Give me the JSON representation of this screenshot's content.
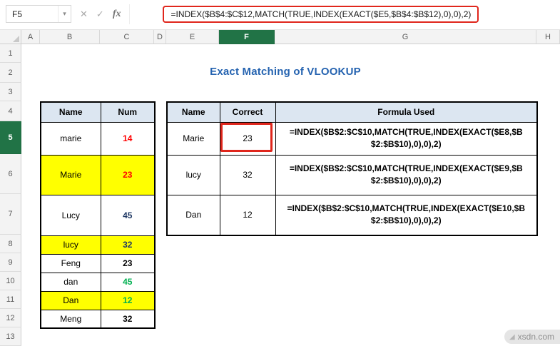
{
  "formula_bar": {
    "name_box": "F5",
    "cancel_icon": "✕",
    "enter_icon": "✓",
    "fx_label": "fx",
    "dropdown_icon": "▼",
    "formula": "=INDEX($B$4:$C$12,MATCH(TRUE,INDEX(EXACT($E5,$B$4:$B$12),0),0),2)"
  },
  "grid": {
    "column_headers": [
      "A",
      "B",
      "C",
      "D",
      "E",
      "F",
      "G",
      "H"
    ],
    "row_headers": [
      "1",
      "2",
      "3",
      "4",
      "5",
      "6",
      "7",
      "8",
      "9",
      "10",
      "11",
      "12",
      "13"
    ],
    "selected_column": "F",
    "selected_row": "5",
    "selected_cell": "F5"
  },
  "title": "Exact Matching of VLOOKUP",
  "left_table": {
    "headers": [
      "Name",
      "Num"
    ],
    "rows": [
      {
        "name": "marie",
        "num": "14",
        "num_color": "#FF0000",
        "bg": "#FFFFFF"
      },
      {
        "name": "Marie",
        "num": "23",
        "num_color": "#FF0000",
        "bg": "#FFFF00"
      },
      {
        "name": "Lucy",
        "num": "45",
        "num_color": "#1F3864",
        "bg": "#FFFFFF"
      },
      {
        "name": "lucy",
        "num": "32",
        "num_color": "#1F3864",
        "bg": "#FFFF00"
      },
      {
        "name": "Feng",
        "num": "23",
        "num_color": "#000000",
        "bg": "#FFFFFF"
      },
      {
        "name": "dan",
        "num": "45",
        "num_color": "#00B050",
        "bg": "#FFFFFF"
      },
      {
        "name": "Dan",
        "num": "12",
        "num_color": "#00B050",
        "bg": "#FFFF00"
      },
      {
        "name": "Meng",
        "num": "32",
        "num_color": "#000000",
        "bg": "#FFFFFF"
      }
    ]
  },
  "right_table": {
    "headers": [
      "Name",
      "Correct",
      "Formula Used"
    ],
    "rows": [
      {
        "name": "Marie",
        "correct": "23",
        "formula": "=INDEX($B$2:$C$10,MATCH(TRUE,INDEX(EXACT($E8,$B$2:$B$10),0),0),2)"
      },
      {
        "name": "lucy",
        "correct": "32",
        "formula": "=INDEX($B$2:$C$10,MATCH(TRUE,INDEX(EXACT($E9,$B$2:$B$10),0),0),2)"
      },
      {
        "name": "Dan",
        "correct": "12",
        "formula": "=INDEX($B$2:$C$10,MATCH(TRUE,INDEX(EXACT($E10,$B$2:$B$10),0),0),2)"
      }
    ]
  },
  "watermark": {
    "icon": "◢",
    "text": "xsdn.com"
  },
  "colors": {
    "highlight_yellow": "#FFFF00",
    "title_blue": "#2563B0",
    "annotation_red": "#E0261C",
    "selected_header_green": "#217346"
  }
}
